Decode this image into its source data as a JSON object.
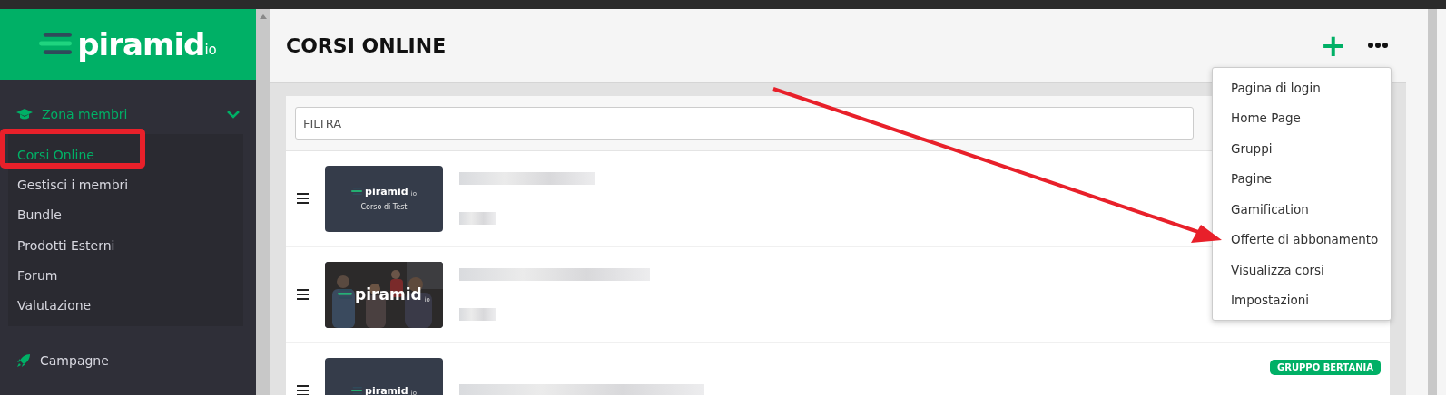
{
  "sidebar": {
    "logo": {
      "name": "piramid",
      "suffix": "io"
    },
    "sections": [
      {
        "label": "Zona membri",
        "kind": "cap",
        "expanded": true,
        "children": [
          {
            "label": "Corsi Online",
            "selected": true
          },
          {
            "label": "Gestisci i membri",
            "selected": false
          },
          {
            "label": "Bundle",
            "selected": false
          },
          {
            "label": "Prodotti Esterni",
            "selected": false
          },
          {
            "label": "Forum",
            "selected": false
          },
          {
            "label": "Valutazione",
            "selected": false
          }
        ]
      },
      {
        "label": "Campagne",
        "kind": "rocket",
        "expanded": false
      }
    ]
  },
  "header": {
    "title": "CORSI ONLINE",
    "add_button": "+"
  },
  "filter": {
    "placeholder": "FILTRA"
  },
  "courses": [
    {
      "thumbnail": {
        "kind": "template",
        "logo": "piramid",
        "suffix": "io",
        "caption": "Corso di Test"
      }
    },
    {
      "thumbnail": {
        "logo": "piramid",
        "suffix": "io"
      }
    },
    {
      "thumbnail": {
        "kind": "template",
        "logo": "piramid",
        "suffix": "io"
      },
      "badge": "GRUPPO BERTANIA"
    }
  ],
  "menu": {
    "items": [
      "Pagina di login",
      "Home Page",
      "Gruppi",
      "Pagine",
      "Gamification",
      "Offerte di abbonamento",
      "Visualizza corsi",
      "Impostazioni"
    ]
  }
}
